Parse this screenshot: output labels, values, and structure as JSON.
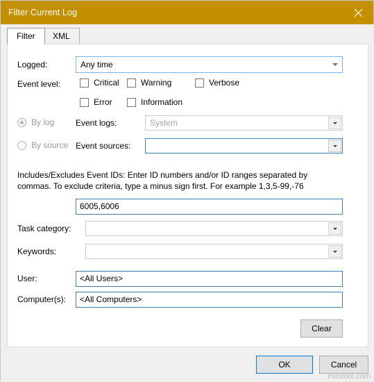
{
  "window": {
    "title": "Filter Current Log",
    "close_label": "Close"
  },
  "tabs": [
    {
      "label": "Filter",
      "selected": true
    },
    {
      "label": "XML",
      "selected": false
    }
  ],
  "fields": {
    "logged_label": "Logged:",
    "logged_value": "Any time",
    "event_level_label": "Event level:",
    "levels": [
      {
        "label": "Critical",
        "checked": false
      },
      {
        "label": "Warning",
        "checked": false
      },
      {
        "label": "Verbose",
        "checked": false
      },
      {
        "label": "Error",
        "checked": false
      },
      {
        "label": "Information",
        "checked": false
      }
    ],
    "by_log_label": "By log",
    "by_source_label": "By source",
    "event_logs_label": "Event logs:",
    "event_logs_value": "System",
    "event_sources_label": "Event sources:",
    "event_sources_value": "",
    "event_ids_help": "Includes/Excludes Event IDs: Enter ID numbers and/or ID ranges separated by commas. To exclude criteria, type a minus sign first. For example 1,3,5-99,-76",
    "event_ids_value": "6005,6006",
    "task_category_label": "Task category:",
    "task_category_value": "",
    "keywords_label": "Keywords:",
    "keywords_value": "",
    "user_label": "User:",
    "user_value": "<All Users>",
    "computers_label": "Computer(s):",
    "computers_value": "<All Computers>"
  },
  "buttons": {
    "clear": "Clear",
    "ok": "OK",
    "cancel": "Cancel"
  },
  "watermark": "minitool.com",
  "colors": {
    "titlebar": "#c39000",
    "accent_border": "#0078d7",
    "field_border": "#3d7eb5"
  }
}
